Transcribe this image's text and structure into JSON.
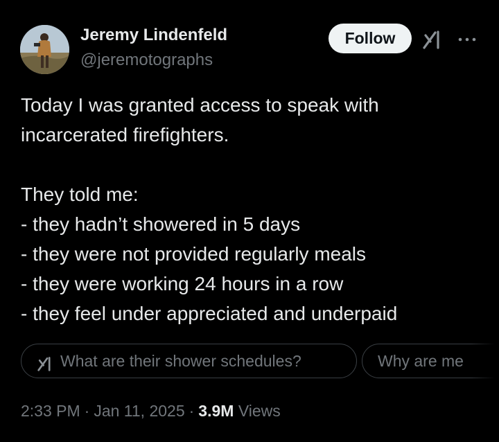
{
  "author": {
    "name": "Jeremy Lindenfeld",
    "handle": "@jeremotographs"
  },
  "actions": {
    "follow_label": "Follow",
    "grok_icon": "grok-icon",
    "more_icon": "more-horizontal-icon"
  },
  "tweet": {
    "line_1": "Today I was granted access to speak with",
    "line_2": "incarcerated firefighters.",
    "line_3": "They told me:",
    "line_4": "- they hadn’t showered in 5 days",
    "line_5": "- they were not provided regularly meals",
    "line_6": "- they were working 24 hours in a row",
    "line_7": "- they feel under appreciated and underpaid"
  },
  "grok_prompts": [
    {
      "label": "What are their shower schedules?",
      "icon": "grok-icon"
    },
    {
      "label": "Why are me"
    }
  ],
  "meta": {
    "time": "2:33 PM",
    "date": "Jan 11, 2025",
    "views_count": "3.9M",
    "views_label": "Views",
    "separator": "·"
  },
  "colors": {
    "background": "#000000",
    "text_primary": "#e7e9ea",
    "text_secondary": "#71767b",
    "follow_button_bg": "#eff3f4",
    "chip_border": "#3a3f44"
  }
}
